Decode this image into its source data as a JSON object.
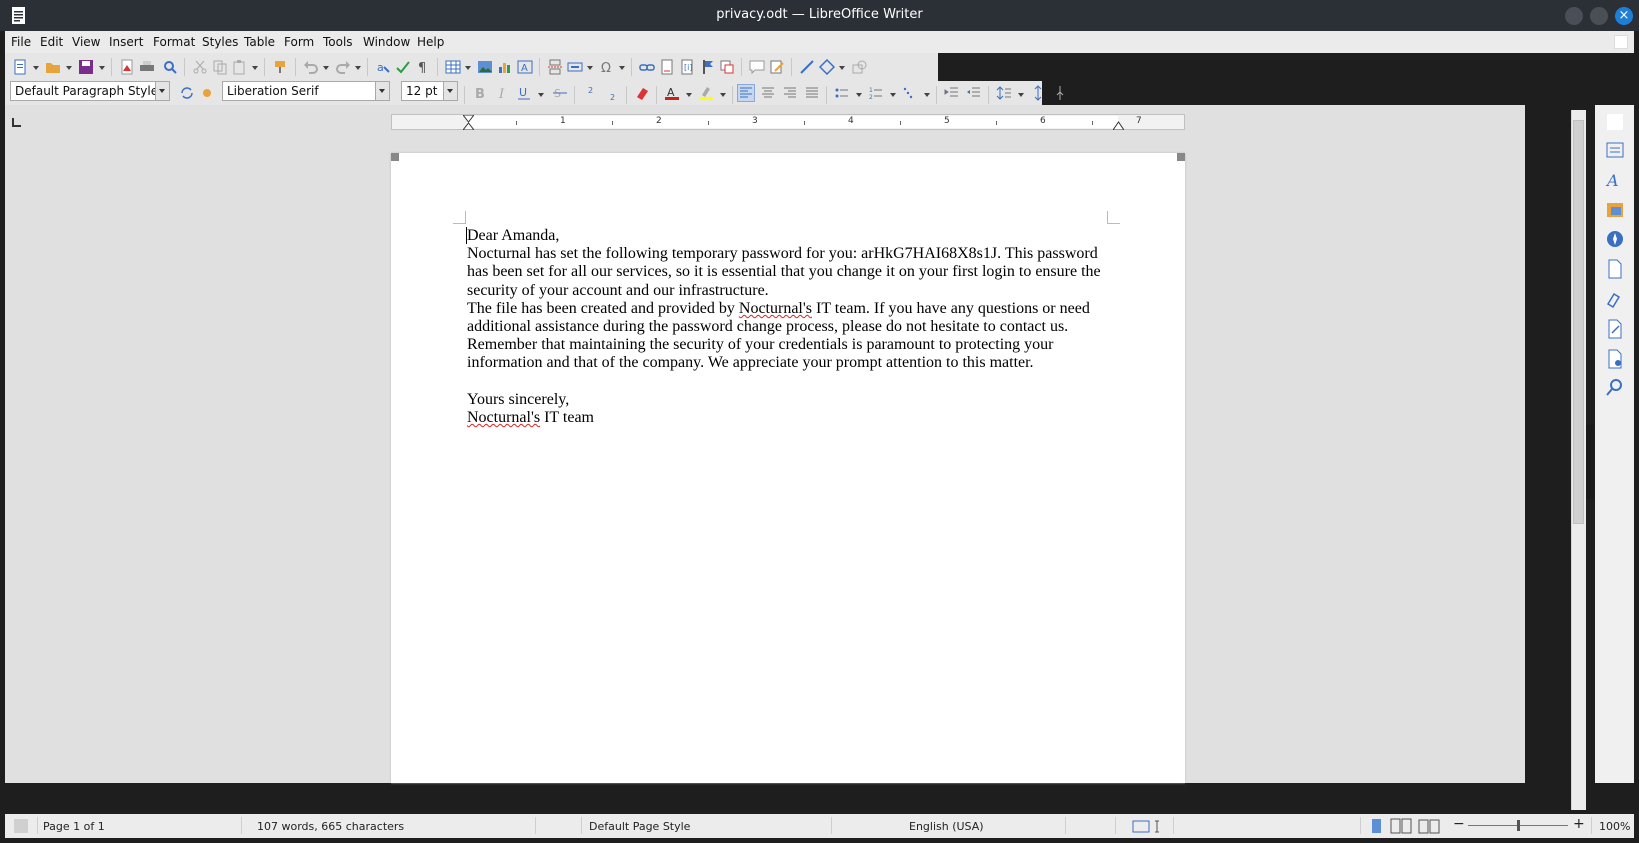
{
  "window": {
    "title": "privacy.odt — LibreOffice Writer",
    "close_glyph": "×"
  },
  "menu": [
    {
      "label": "File"
    },
    {
      "label": "Edit"
    },
    {
      "label": "View"
    },
    {
      "label": "Insert"
    },
    {
      "label": "Format"
    },
    {
      "label": "Styles"
    },
    {
      "label": "Table"
    },
    {
      "label": "Form"
    },
    {
      "label": "Tools"
    },
    {
      "label": "Window"
    },
    {
      "label": "Help"
    }
  ],
  "formatting": {
    "paragraph_style": "Default Paragraph Style",
    "font_name": "Liberation Serif",
    "font_size": "12 pt"
  },
  "ruler": {
    "labels": [
      "1",
      "2",
      "3",
      "4",
      "5",
      "6",
      "7"
    ]
  },
  "document": {
    "greeting": "Dear Amanda,",
    "para1": "Nocturnal has set the following temporary password for you: arHkG7HAI68X8s1J. This password has been set for all our services, so it is essential that you change it on your first login to ensure the security of your account and our infrastructure.",
    "para2_pre": "The file has been created and provided by ",
    "para2_word": "Nocturnal's",
    "para2_post": " IT team. If you have any questions or need additional assistance during the password change process, please do not hesitate to contact us. Remember that maintaining the security of your credentials is paramount to protecting your information and that of the company. We appreciate your prompt attention to this matter.",
    "closing": "Yours sincerely,",
    "sig_word": "Nocturnal's",
    "sig_rest": " IT team"
  },
  "status": {
    "page": "Page 1 of 1",
    "words": "107 words, 665 characters",
    "page_style": "Default Page Style",
    "language": "English (USA)",
    "zoom": "100%",
    "zoom_minus": "−",
    "zoom_plus": "+"
  },
  "colors": {
    "font_color": "#c9211e",
    "highlight": "#ffff00",
    "accent": "#1e7fd8"
  }
}
